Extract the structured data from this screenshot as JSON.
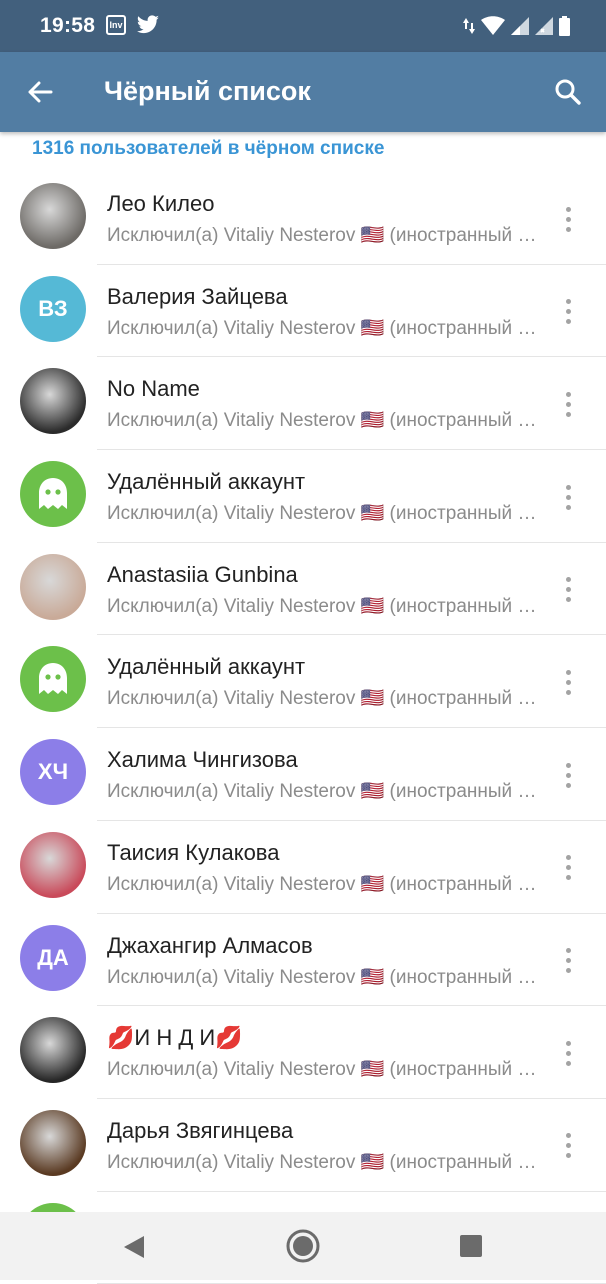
{
  "status_bar": {
    "time": "19:58",
    "inv_label": "Inv",
    "icons": [
      "inv-app-icon",
      "twitter-icon",
      "data-arrows-icon",
      "wifi-icon",
      "signal-icon",
      "signal-x-icon",
      "battery-icon"
    ]
  },
  "app_bar": {
    "title": "Чёрный список",
    "back_icon": "arrow-left-icon",
    "search_icon": "search-icon",
    "background": "#527da3"
  },
  "count_header": "1316 пользователей в чёрном списке",
  "colors": {
    "accent_text": "#3a95d5",
    "status_bar": "#42607d",
    "deleted_green": "#6cc04a",
    "teal": "#55b9d6",
    "purple": "#8c7ee8"
  },
  "users": [
    {
      "name": "Лео Килео",
      "subtitle": "Исключил(а) Vitaliy Nesterov 🇺🇸 (иностранный агент)",
      "avatar_type": "photo",
      "avatar_color": "#6d6a66"
    },
    {
      "name": "Валерия Зайцева",
      "subtitle": "Исключил(а) Vitaliy Nesterov 🇺🇸 (иностранный агент)",
      "avatar_type": "initials",
      "initials": "ВЗ",
      "avatar_color": "#55b9d6"
    },
    {
      "name": "No Name",
      "subtitle": "Исключил(а) Vitaliy Nesterov 🇺🇸 (иностранный агент)",
      "avatar_type": "photo",
      "avatar_color": "#2b2b2b"
    },
    {
      "name": "Удалённый аккаунт",
      "subtitle": "Исключил(а) Vitaliy Nesterov 🇺🇸 (иностранный агент)",
      "avatar_type": "ghost",
      "avatar_color": "#6cc04a"
    },
    {
      "name": "Anastasiia Gunbina",
      "subtitle": "Исключил(а) Vitaliy Nesterov 🇺🇸 (иностранный агент)",
      "avatar_type": "photo",
      "avatar_color": "#c9aa98"
    },
    {
      "name": "Удалённый аккаунт",
      "subtitle": "Исключил(а) Vitaliy Nesterov 🇺🇸 (иностранный агент)",
      "avatar_type": "ghost",
      "avatar_color": "#6cc04a"
    },
    {
      "name": "Халима Чингизова",
      "subtitle": "Исключил(а) Vitaliy Nesterov 🇺🇸 (иностранный агент)",
      "avatar_type": "initials",
      "initials": "ХЧ",
      "avatar_color": "#8c7ee8"
    },
    {
      "name": "Таисия Кулакова",
      "subtitle": "Исключил(а) Vitaliy Nesterov 🇺🇸 (иностранный агент)",
      "avatar_type": "photo",
      "avatar_color": "#c94a5a"
    },
    {
      "name": "Джахангир Алмасов",
      "subtitle": "Исключил(а) Vitaliy Nesterov 🇺🇸 (иностранный агент)",
      "avatar_type": "initials",
      "initials": "ДА",
      "avatar_color": "#8c7ee8"
    },
    {
      "name": "💋И Н Д И💋",
      "subtitle": "Исключил(а) Vitaliy Nesterov 🇺🇸 (иностранный агент)",
      "avatar_type": "photo",
      "avatar_color": "#262626"
    },
    {
      "name": "Дарья Звягинцева",
      "subtitle": "Исключил(а) Vitaliy Nesterov 🇺🇸 (иностранный агент)",
      "avatar_type": "photo",
      "avatar_color": "#5a3a22"
    },
    {
      "name": "",
      "subtitle": "",
      "avatar_type": "ghost",
      "avatar_color": "#6cc04a"
    }
  ],
  "nav_bar": {
    "icons": [
      "nav-back-icon",
      "nav-home-icon",
      "nav-recents-icon"
    ]
  }
}
